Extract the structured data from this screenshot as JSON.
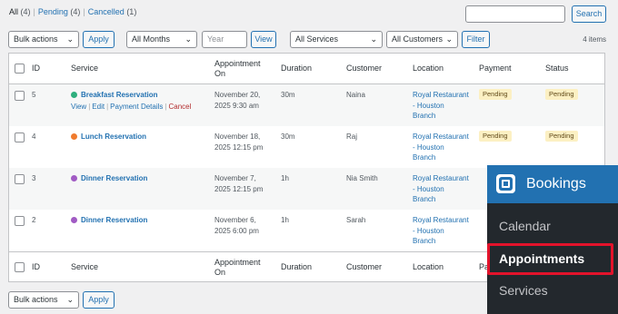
{
  "views": {
    "all": {
      "label": "All",
      "count": "(4)"
    },
    "pending": {
      "label": "Pending",
      "count": "(4)"
    },
    "cancelled": {
      "label": "Cancelled",
      "count": "(1)"
    }
  },
  "search": {
    "button": "Search",
    "value": ""
  },
  "filters": {
    "bulk_actions": "Bulk actions",
    "apply": "Apply",
    "months": "All Months",
    "year_placeholder": "Year",
    "view": "View",
    "services": "All Services",
    "customers": "All Customers",
    "filter": "Filter",
    "items_count": "4 items"
  },
  "table": {
    "headers": {
      "id": "ID",
      "service": "Service",
      "appointment_on_line1": "Appointment",
      "appointment_on_line2": "On",
      "duration": "Duration",
      "customer": "Customer",
      "location": "Location",
      "payment": "Payment",
      "status": "Status"
    },
    "footer_payment_partial": "Pa",
    "row_actions": {
      "view": "View",
      "edit": "Edit",
      "payment_details": "Payment Details",
      "cancel": "Cancel"
    },
    "rows": [
      {
        "id": "5",
        "service": "Breakfast Reservation",
        "dot_color": "#2eaf7d",
        "date_line1": "November 20,",
        "date_line2": "2025 9:30 am",
        "duration": "30m",
        "customer": "Naina",
        "loc1": "Royal Restaurant",
        "loc2": "- Houston",
        "loc3": "Branch",
        "payment": "Pending",
        "status": "Pending"
      },
      {
        "id": "4",
        "service": "Lunch Reservation",
        "dot_color": "#f07b2e",
        "date_line1": "November 18,",
        "date_line2": "2025 12:15 pm",
        "duration": "30m",
        "customer": "Raj",
        "loc1": "Royal Restaurant",
        "loc2": "- Houston",
        "loc3": "Branch",
        "payment": "Pending",
        "status": "Pending"
      },
      {
        "id": "3",
        "service": "Dinner Reservation",
        "dot_color": "#a15bc4",
        "date_line1": "November 7,",
        "date_line2": "2025 12:15 pm",
        "duration": "1h",
        "customer": "Nia Smith",
        "loc1": "Royal Restaurant",
        "loc2": "- Houston",
        "loc3": "Branch",
        "payment": "",
        "status": ""
      },
      {
        "id": "2",
        "service": "Dinner Reservation",
        "dot_color": "#a15bc4",
        "date_line1": "November 6,",
        "date_line2": "2025 6:00 pm",
        "duration": "1h",
        "customer": "Sarah",
        "loc1": "Royal Restaurant",
        "loc2": "- Houston",
        "loc3": "Branch",
        "payment": "",
        "status": ""
      }
    ]
  },
  "bookings_menu": {
    "title": "Bookings",
    "items": [
      "Calendar",
      "Appointments",
      "Services"
    ]
  },
  "colors": {
    "accent": "#2271b1",
    "highlight": "#e3132b",
    "badge_bg": "#fcf0c3"
  }
}
